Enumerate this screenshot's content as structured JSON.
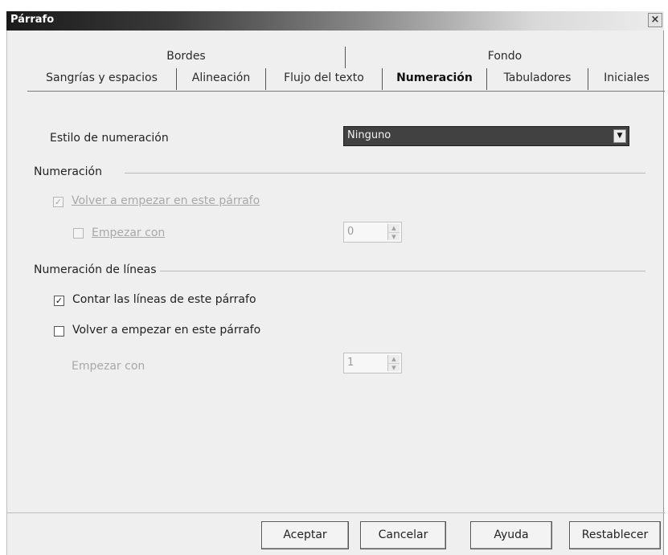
{
  "window": {
    "title": "Párrafo",
    "close_glyph": "×"
  },
  "tabs": {
    "top": [
      {
        "label": "Bordes"
      },
      {
        "label": "Fondo"
      }
    ],
    "bottom": [
      {
        "label": "Sangrías y espacios",
        "active": false
      },
      {
        "label": "Alineación",
        "active": false
      },
      {
        "label": "Flujo del texto",
        "active": false
      },
      {
        "label": "Numeración",
        "active": true
      },
      {
        "label": "Tabuladores",
        "active": false
      },
      {
        "label": "Iniciales",
        "active": false
      }
    ]
  },
  "numbering_style": {
    "label": "Estilo de numeración",
    "value": "Ninguno",
    "icon": "chevron-down-icon"
  },
  "numbering_section": {
    "title": "Numeración",
    "restart_label": "Volver a empezar en este párrafo",
    "restart_checked": true,
    "restart_enabled": false,
    "start_with_label": "Empezar con",
    "start_with_checked": false,
    "start_with_enabled": false,
    "start_value": "0"
  },
  "line_numbering_section": {
    "title": "Numeración de líneas",
    "count_lines_label": "Contar las líneas de este párrafo",
    "count_lines_checked": true,
    "restart_label": "Volver a empezar en este párrafo",
    "restart_checked": false,
    "start_with_label": "Empezar con",
    "start_with_enabled": false,
    "start_value": "1"
  },
  "buttons": {
    "ok": "Aceptar",
    "cancel": "Cancelar",
    "help": "Ayuda",
    "reset": "Restablecer"
  },
  "colors": {
    "dialog_bg": "#efefef",
    "dropdown_bg": "#414141",
    "titlebar_start": "#1a1a1a"
  }
}
